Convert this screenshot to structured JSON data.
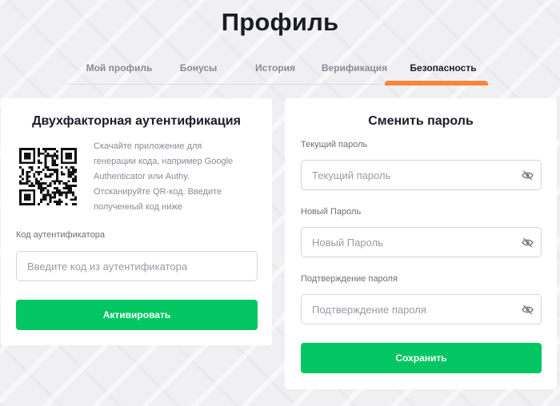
{
  "header": {
    "title": "Профиль"
  },
  "tabs": [
    {
      "label": "Мой профиль",
      "active": false
    },
    {
      "label": "Бонусы",
      "active": false
    },
    {
      "label": "История",
      "active": false
    },
    {
      "label": "Верификация",
      "active": false
    },
    {
      "label": "Безопасность",
      "active": true
    }
  ],
  "colors": {
    "accent_tab": "#f5883a",
    "button": "#02c662",
    "text_dark": "#1c1c28",
    "text_muted": "#8a8a96"
  },
  "two_factor": {
    "title": "Двухфакторная аутентификация",
    "qr_icon": "qr-code-icon",
    "description": [
      "Скачайте приложение для",
      "генерации кода, например Google",
      "Authenticator или Authy.",
      "Отсканируйте QR-код. Введите",
      "полученный код ниже"
    ],
    "code_label": "Код аутентификатора",
    "code_value": "",
    "code_placeholder": "Введите код из аутентификатора",
    "activate_label": "Активировать"
  },
  "change_password": {
    "title": "Сменить пароль",
    "current_label": "Текущий пароль",
    "current_value": "",
    "current_placeholder": "Текущий пароль",
    "new_label": "Новый Пароль",
    "new_value": "",
    "new_placeholder": "Новый Пароль",
    "confirm_label": "Подтверждение пароля",
    "confirm_value": "",
    "confirm_placeholder": "Подтверждение пароля",
    "toggle_icon": "eye-off-icon",
    "save_label": "Сохранить"
  }
}
